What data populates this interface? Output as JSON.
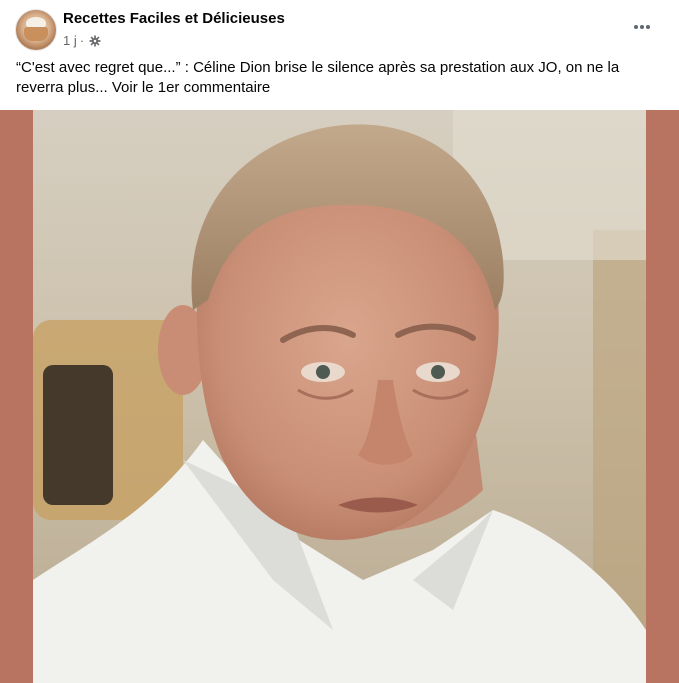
{
  "post": {
    "page_name": "Recettes Faciles et Délicieuses",
    "time": "1 j",
    "separator": "·",
    "audience_icon": "public-gear-icon",
    "more_icon": "more-options-icon",
    "caption": "“C'est avec regret que...” : Céline Dion brise le silence après sa prestation aux JO, on ne la reverra plus... Voir le 1er commentaire",
    "image_alt": "Photo of a tearful woman with slicked-back hair in a white shirt",
    "colors": {
      "frame_background": "#b97461",
      "name_text": "#050505",
      "meta_text": "#65676b"
    }
  }
}
